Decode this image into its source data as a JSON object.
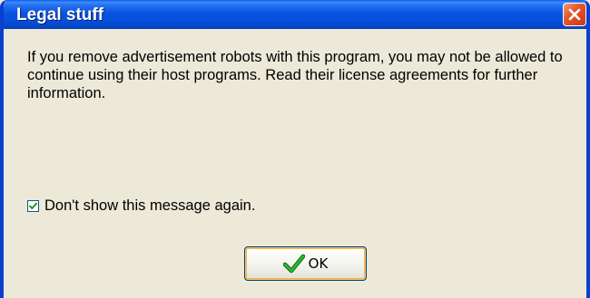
{
  "window": {
    "title": "Legal stuff"
  },
  "dialog": {
    "message": "If you remove advertisement robots with this program, you may not be allowed to continue using their host programs. Read their license agreements for further information.",
    "checkbox": {
      "label": "Don't show this message again.",
      "checked": true
    },
    "ok_button": {
      "label": "OK",
      "icon": "checkmark-icon"
    }
  },
  "icons": {
    "close": "close-icon",
    "checkbox": "checkmark-icon"
  },
  "colors": {
    "titlebar": "#0A5DF0",
    "window_border": "#0A3FD0",
    "dialog_background": "#ECE9D8",
    "close_button": "#E5582E",
    "checkmark": "#1A9A1A"
  }
}
